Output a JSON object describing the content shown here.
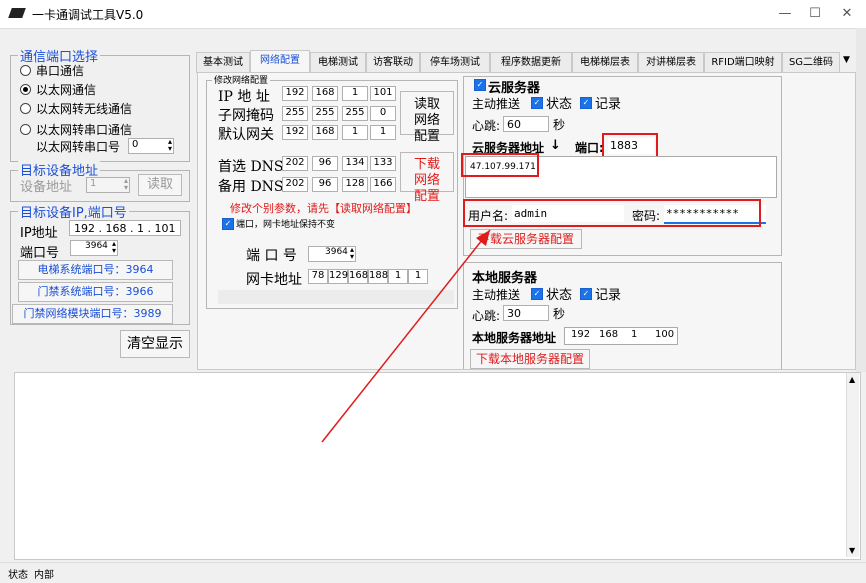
{
  "window": {
    "title": "一卡通调试工具V5.0"
  },
  "left": {
    "port_group_title": "通信端口选择",
    "radios": [
      "串口通信",
      "以太网通信",
      "以太网转无线通信",
      "以太网转串口通信"
    ],
    "serial_port_label": "以太网转串口号",
    "serial_port_value": "0",
    "target_addr_title": "目标设备地址",
    "device_addr_label": "设备地址",
    "device_addr_value": "1",
    "read_button": "读取",
    "ip_group_title": "目标设备IP,端口号",
    "ip_label": "IP地址",
    "ip_value": "192 . 168 . 1 . 101",
    "port_label": "端口号",
    "port_value": "3964",
    "preset_buttons": [
      "电梯系统端口号：3964",
      "门禁系统端口号：3966",
      "门禁网络模块端口号：3989"
    ],
    "clear_button": "清空显示"
  },
  "tabs": [
    "基本测试",
    "网络配置",
    "电梯测试",
    "访客联动",
    "停车场测试",
    "程序数据更新",
    "电梯梯层表",
    "对讲梯层表",
    "RFID端口映射",
    "SG二维码"
  ],
  "net": {
    "group_title": "修改网络配置",
    "ip_label": "IP 地 址",
    "ip": [
      "192",
      "168",
      "1",
      "101"
    ],
    "mask_label": "子网掩码",
    "mask": [
      "255",
      "255",
      "255",
      "0"
    ],
    "gw_label": "默认网关",
    "gw": [
      "192",
      "168",
      "1",
      "1"
    ],
    "read_cfg_button": "读取网络配置",
    "dns1_label": "首选 DNS",
    "dns1": [
      "202",
      "96",
      "134",
      "133"
    ],
    "dns2_label": "备用 DNS",
    "dns2": [
      "202",
      "96",
      "128",
      "166"
    ],
    "download_cfg_button": "下载网络配置",
    "warning": "修改个别参数，请先【读取网络配置】",
    "keep_label": "端口，网卡地址保持不变",
    "port_label": "端 口 号",
    "port_value": "3964",
    "mac_label": "网卡地址",
    "mac": [
      "78",
      "129",
      "168",
      "188",
      "1",
      "1"
    ]
  },
  "cloud": {
    "title": "云服务器",
    "push_label": "主动推送",
    "status_label": "状态",
    "record_label": "记录",
    "heartbeat_label": "心跳:",
    "heartbeat_value": "60",
    "sec_label": "秒",
    "addr_label": "云服务器地址",
    "arrow": "↓",
    "port_label": "端口:",
    "port_value": "1883",
    "addr_value": "47.107.99.171",
    "user_label": "用户名:",
    "user_value": "admin",
    "pwd_label": "密码:",
    "pwd_value": "***********",
    "download_button": "下载云服务器配置"
  },
  "local": {
    "title": "本地服务器",
    "push_label": "主动推送",
    "status_label": "状态",
    "record_label": "记录",
    "heartbeat_label": "心跳:",
    "heartbeat_value": "30",
    "sec_label": "秒",
    "addr_label": "本地服务器地址",
    "addr": [
      "192",
      "168",
      "1",
      "100"
    ],
    "download_button": "下载本地服务器配置"
  },
  "statusbar": {
    "label": "状态",
    "value": "内部"
  },
  "colors": {
    "accent": "#1a4fd6",
    "warning": "#e01b1b"
  }
}
